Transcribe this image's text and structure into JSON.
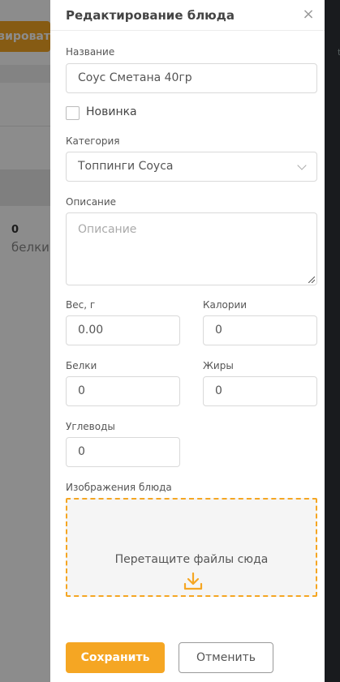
{
  "background": {
    "orange_button_text": "зироват",
    "protein_value": "0",
    "protein_label": "белки",
    "right_edge_text": "t"
  },
  "modal": {
    "title": "Редактирование блюда",
    "close_glyph": "×",
    "name": {
      "label": "Название",
      "value": "Соус Сметана 40гр"
    },
    "novelty": {
      "label": "Новинка",
      "checked": false
    },
    "category": {
      "label": "Категория",
      "value": "Топпинги Соуса"
    },
    "description": {
      "label": "Описание",
      "placeholder": "Описание"
    },
    "weight": {
      "label": "Вес, г",
      "value": "0.00"
    },
    "calories": {
      "label": "Калории",
      "value": "0"
    },
    "proteins": {
      "label": "Белки",
      "value": "0"
    },
    "fats": {
      "label": "Жиры",
      "value": "0"
    },
    "carbs": {
      "label": "Углеводы",
      "value": "0"
    },
    "images": {
      "label": "Изображения блюда",
      "dropzone_text": "Перетащите файлы сюда"
    },
    "save_label": "Сохранить",
    "cancel_label": "Отменить"
  },
  "colors": {
    "accent": "#f5a623",
    "overlay": "rgba(0,0,0,0.45)"
  }
}
